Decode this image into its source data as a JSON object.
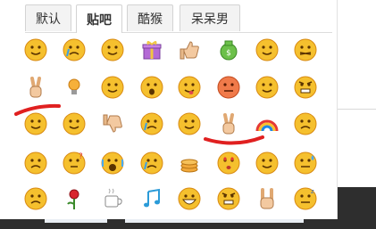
{
  "tabs": [
    {
      "label": "默认",
      "active": false
    },
    {
      "label": "贴吧",
      "active": true
    },
    {
      "label": "酷猴",
      "active": false
    },
    {
      "label": "呆呆男",
      "active": false
    }
  ],
  "emoji_rows": [
    [
      "face-grin-icon",
      "face-cry-icon",
      "face-shy-icon",
      "gift-icon",
      "thumbs-up-icon",
      "money-bag-icon",
      "face-smile-icon",
      "face-cross-icon"
    ],
    [
      "victory-hand-icon",
      "light-bulb-icon",
      "face-smile-icon",
      "face-surprise-icon",
      "face-tongue-icon",
      "face-red-icon",
      "face-grin-icon",
      "face-angry-icon"
    ],
    [
      "face-dizzy-icon",
      "face-wave-icon",
      "thumbs-down-icon",
      "face-cry-icon",
      "face-smug-icon",
      "victory-hand-icon",
      "rainbow-icon",
      "face-sad-icon"
    ],
    [
      "face-frown-icon",
      "face-question-icon",
      "face-scream-icon",
      "face-cry-icon",
      "coins-icon",
      "face-love-icon",
      "face-grin-icon",
      "face-sweat-icon"
    ],
    [
      "face-sad-icon",
      "rose-icon",
      "coffee-cup-icon",
      "music-note-icon",
      "face-big-smile-icon",
      "face-angry-icon",
      "rock-hand-icon",
      "face-sleep-icon"
    ]
  ],
  "colors": {
    "face": "#f5c02e",
    "face_edge": "#d88a12",
    "annotation": "#e02020",
    "tab_border": "#d3d3d3"
  }
}
